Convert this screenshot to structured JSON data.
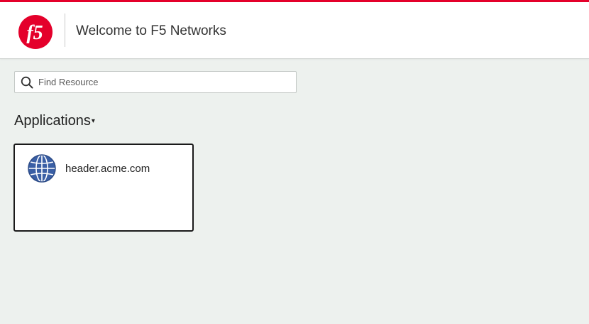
{
  "header": {
    "logo_text": "f5",
    "title": "Welcome to F5 Networks"
  },
  "search": {
    "placeholder": "Find Resource",
    "value": ""
  },
  "applications": {
    "heading": "Applications",
    "caret": "▾",
    "items": [
      {
        "label": "header.acme.com",
        "icon": "globe-icon"
      }
    ]
  },
  "colors": {
    "brand_red": "#e4002b",
    "background": "#edf1ee",
    "globe_blue": "#3a5fa5"
  }
}
